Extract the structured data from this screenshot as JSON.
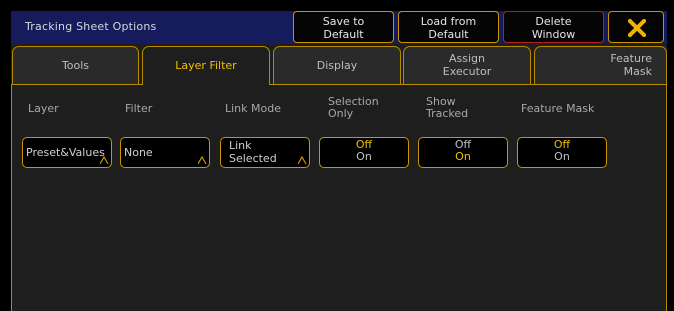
{
  "window": {
    "title": "Tracking Sheet  Options",
    "buttons": {
      "save": [
        "Save to",
        "Default"
      ],
      "load": [
        "Load from",
        "Default"
      ],
      "delete": [
        "Delete",
        "Window"
      ]
    }
  },
  "tabs": {
    "tools": "Tools",
    "layer_filter": "Layer Filter",
    "display": "Display",
    "assign_executor": [
      "Assign",
      "Executor"
    ],
    "feature_mask": [
      "Feature",
      "Mask"
    ]
  },
  "columns": {
    "layer": "Layer",
    "filter": "Filter",
    "link_mode": "Link Mode",
    "selection_only": [
      "Selection",
      "Only"
    ],
    "show_tracked": [
      "Show",
      "Tracked"
    ],
    "feature_mask": "Feature Mask"
  },
  "controls": {
    "layer_value": "Preset&Values",
    "filter_value": "None",
    "link_mode_value": [
      "Link",
      "Selected"
    ],
    "selection_only": {
      "off": "Off",
      "on": "On",
      "selected": "Off"
    },
    "show_tracked": {
      "off": "Off",
      "on": "On",
      "selected": "On"
    },
    "feature_mask": {
      "off": "Off",
      "on": "On",
      "selected": "Off"
    }
  },
  "colors": {
    "accent": "#f0c000",
    "border": "#c89400",
    "titlebar": "#161b5c",
    "delete_border": "#b02020"
  }
}
